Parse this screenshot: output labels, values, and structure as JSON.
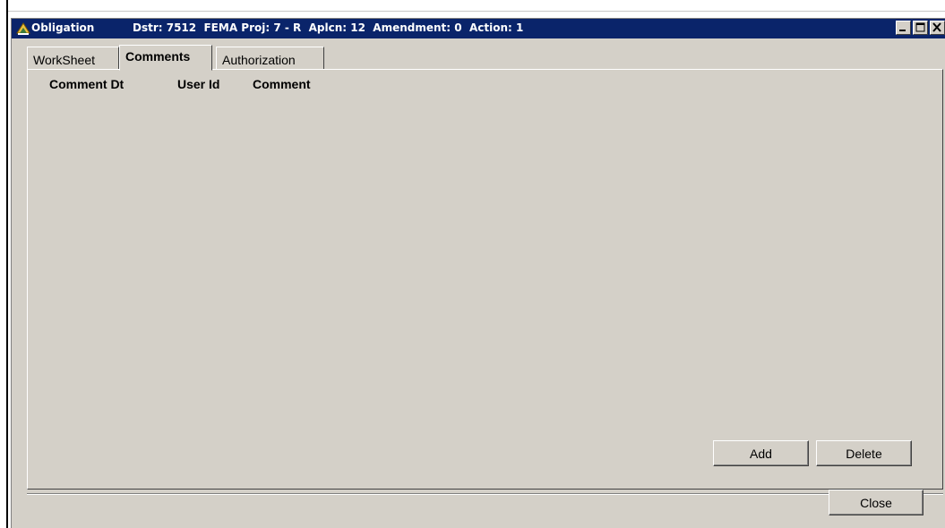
{
  "titlebar": {
    "title": "Obligation",
    "info": "Dstr: 7512  FEMA Proj: 7 - R  Aplcn: 12  Amendment: 0  Action: 1"
  },
  "window_controls": {
    "minimize_icon": "minimize-icon",
    "maximize_icon": "maximize-icon",
    "close_icon": "close-icon"
  },
  "tabs": [
    {
      "label": "WorkSheet",
      "active": false
    },
    {
      "label": "Comments",
      "active": true
    },
    {
      "label": "Authorization",
      "active": false
    }
  ],
  "comments_table": {
    "columns": [
      "Comment Dt",
      "User Id",
      "Comment"
    ],
    "rows": []
  },
  "buttons": {
    "add": "Add",
    "delete": "Delete",
    "close": "Close"
  },
  "colors": {
    "titlebar_bg": "#0a246a",
    "window_bg": "#d4d0c8"
  }
}
